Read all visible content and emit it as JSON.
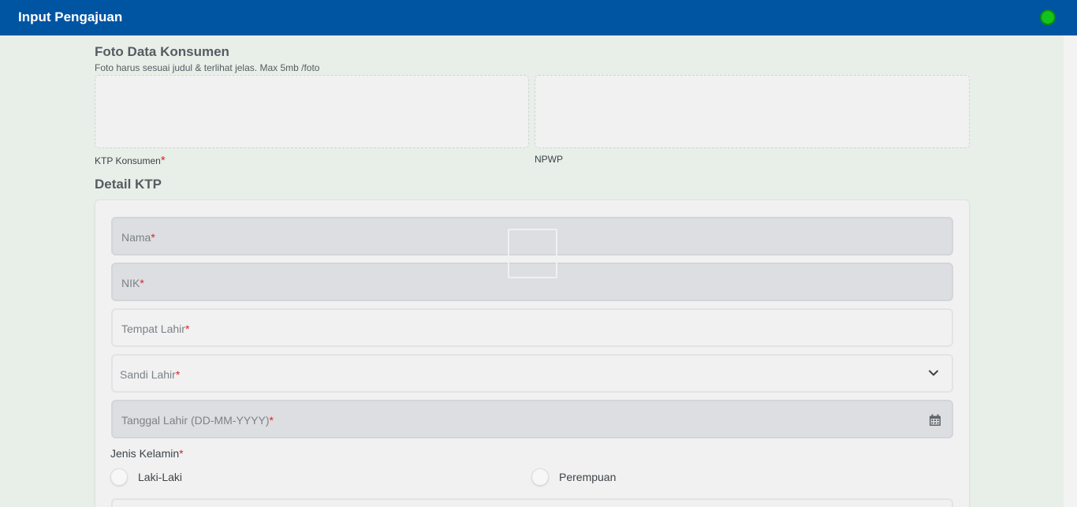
{
  "header": {
    "title": "Input Pengajuan",
    "status_color": "#14c41d"
  },
  "photo_section": {
    "title": "Foto Data Konsumen",
    "subtitle": "Foto harus sesuai judul & terlihat jelas. Max 5mb /foto",
    "uploads": [
      {
        "label": "KTP Konsumen",
        "required": "*"
      },
      {
        "label": "NPWP"
      }
    ]
  },
  "ktp_section": {
    "title": "Detail KTP",
    "fields": {
      "nama": {
        "label": "Nama",
        "required": "*"
      },
      "nik": {
        "label": "NIK",
        "required": "*"
      },
      "tempat_lahir": {
        "label": "Tempat Lahir",
        "required": "*"
      },
      "sandi_lahir": {
        "label": "Sandi Lahir",
        "required": "*",
        "icon": "chevron-down-icon"
      },
      "tanggal_lahir": {
        "label": "Tanggal Lahir (DD-MM-YYYY)",
        "required": "*",
        "icon": "calendar-icon"
      }
    },
    "gender": {
      "label": "Jenis Kelamin",
      "required": "*",
      "options": [
        "Laki-Laki",
        "Perempuan"
      ]
    }
  },
  "colors": {
    "header_bg": "#0055a3",
    "page_bg": "#e8efe8",
    "required": "#d9232d"
  }
}
